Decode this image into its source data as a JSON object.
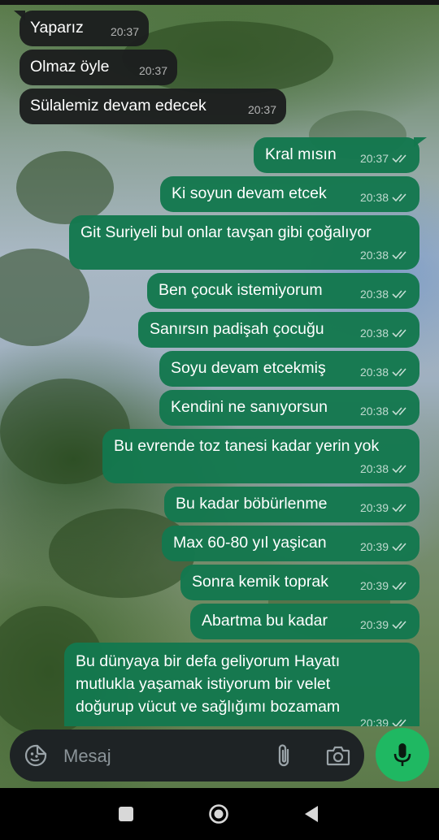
{
  "chat": {
    "messages": [
      {
        "dir": "in",
        "text": "Yaparız",
        "time": "20:37"
      },
      {
        "dir": "in",
        "text": "Olmaz öyle",
        "time": "20:37"
      },
      {
        "dir": "in",
        "text": "Sülalemiz devam edecek",
        "time": "20:37"
      },
      {
        "dir": "out",
        "text": "Kral mısın",
        "time": "20:37"
      },
      {
        "dir": "out",
        "text": "Ki soyun devam etcek",
        "time": "20:38"
      },
      {
        "dir": "out",
        "text": "Git Suriyeli bul onlar tavşan gibi çoğalıyor",
        "time": "20:38"
      },
      {
        "dir": "out",
        "text": "Ben çocuk istemiyorum",
        "time": "20:38"
      },
      {
        "dir": "out",
        "text": "Sanırsın padişah çocuğu",
        "time": "20:38"
      },
      {
        "dir": "out",
        "text": "Soyu devam etcekmiş",
        "time": "20:38"
      },
      {
        "dir": "out",
        "text": "Kendini ne sanıyorsun",
        "time": "20:38"
      },
      {
        "dir": "out",
        "text": "Bu evrende toz tanesi kadar yerin yok",
        "time": "20:38"
      },
      {
        "dir": "out",
        "text": "Bu kadar böbürlenme",
        "time": "20:39"
      },
      {
        "dir": "out",
        "text": "Max 60-80 yıl yaşican",
        "time": "20:39"
      },
      {
        "dir": "out",
        "text": "Sonra kemik toprak",
        "time": "20:39"
      },
      {
        "dir": "out",
        "text": "Abartma bu kadar",
        "time": "20:39"
      },
      {
        "dir": "out",
        "text": "Bu dünyaya bir defa geliyorum Hayatı mutlukla yaşamak istiyorum bir velet doğurup vücut ve sağlığımı bozamam",
        "lines": [
          "Bu dünyaya bir defa geliyorum Hayatı",
          "mutlukla yaşamak istiyorum bir velet",
          "doğurup vücut ve sağlığımı bozamam"
        ],
        "time": "20:39"
      }
    ]
  },
  "composer": {
    "placeholder": "Mesaj",
    "emoji_icon": "sticker-emoji-icon",
    "attach_icon": "paperclip-icon",
    "camera_icon": "camera-icon",
    "mic_icon": "microphone-icon"
  },
  "colors": {
    "outgoing_bubble": "#14784e",
    "incoming_bubble": "#1c1e1e",
    "mic_button": "#1fb862",
    "composer_bg": "#1e2325"
  },
  "navigation": {
    "recents_icon": "recents-square-icon",
    "home_icon": "home-circle-icon",
    "back_icon": "back-triangle-icon"
  }
}
